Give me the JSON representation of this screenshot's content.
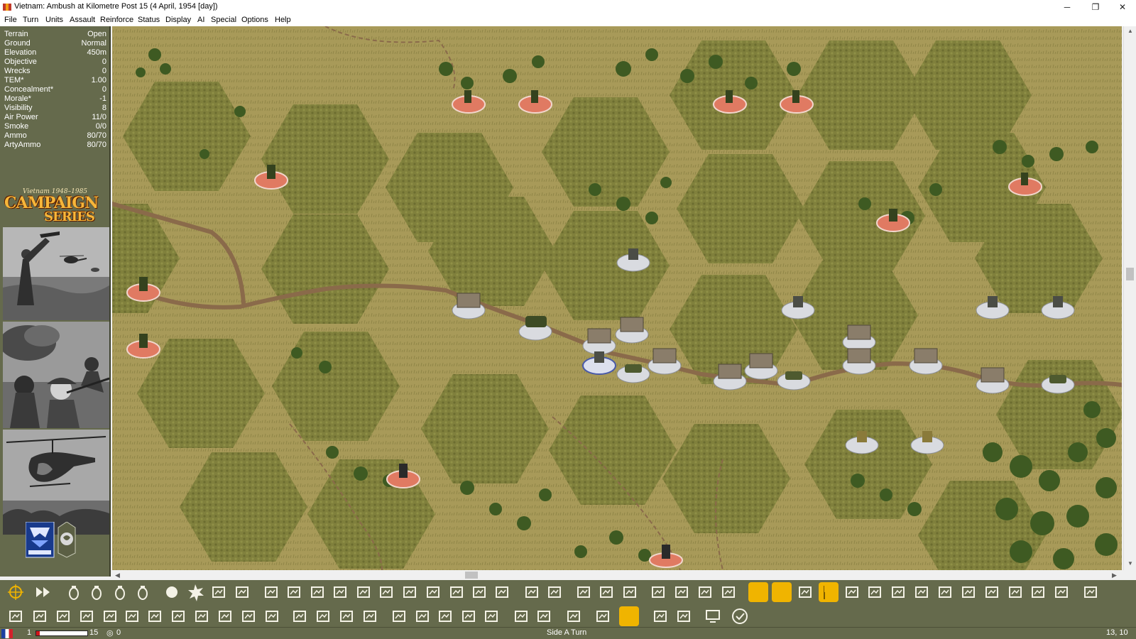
{
  "window": {
    "title": "Vietnam: Ambush at Kilometre Post 15 (4 April, 1954 [day])",
    "controls": {
      "minimize": "─",
      "maximize": "❐",
      "close": "✕"
    }
  },
  "menu": [
    "File",
    "Turn",
    "Units",
    "Assault",
    "Reinforce",
    "Status",
    "Display",
    "AI",
    "Special",
    "Options",
    "Help"
  ],
  "info_panel": [
    {
      "label": "Terrain",
      "value": "Open"
    },
    {
      "label": "Ground",
      "value": "Normal"
    },
    {
      "label": "Elevation",
      "value": "450m"
    },
    {
      "label": "Objective",
      "value": "0"
    },
    {
      "label": "Wrecks",
      "value": "0"
    },
    {
      "label": "TEM*",
      "value": "1.00"
    },
    {
      "label": "Concealment*",
      "value": "0"
    },
    {
      "label": "Morale*",
      "value": "-1"
    },
    {
      "label": "Visibility",
      "value": "8"
    },
    {
      "label": "Air Power",
      "value": "11/0"
    },
    {
      "label": "Smoke",
      "value": "0/0"
    },
    {
      "label": "Ammo",
      "value": "80/70"
    },
    {
      "label": "ArtyAmmo",
      "value": "80/70"
    }
  ],
  "logo": {
    "subtitle": "Vietnam 1948–1985",
    "line1": "CAMPAIGN",
    "line2": "SERIES"
  },
  "scrollbars": {
    "up": "▲",
    "down": "▼",
    "left": "◀",
    "right": "▶"
  },
  "colors": {
    "panel_bg": "#656a4c",
    "map_open": "#a89a59",
    "brush": "#7e7f3b",
    "road": "#8a6a4a",
    "enemy_unit": "#e07a62",
    "friendly_unit": "#d9dbe0",
    "highlight": "#f0b400"
  },
  "toolbar_row1": [
    "target-icon",
    "fast-forward-icon",
    "hand-grenade-icon",
    "hand-grenade-icon",
    "hand-grenade-icon",
    "hand-grenade-icon",
    "smoke-icon",
    "explosion-icon",
    "los-icon",
    "scissors-icon",
    "vehicle-icon",
    "wrench-icon",
    "chart-icon",
    "aircraft-icon",
    "bunker-icon",
    "bunker-icon",
    "building-icon",
    "ladder-icon",
    "rifle-icon",
    "rifle-icon",
    "shovel-icon",
    "helicopter-icon",
    "helicopter-icon",
    "airstrike-icon",
    "transport-icon",
    "mount-icon",
    "dismount-icon",
    "unit-group-icon",
    "gun-icon",
    "truck-icon",
    "speedometer-icon",
    "oval-icon",
    "flag-outline-icon",
    "flag-icon",
    "map-icon",
    "crossed-tools-icon",
    "group-icon",
    "star-icon",
    "map-icon",
    "map-icon",
    "compass-icon",
    "hexes-icon",
    "rotate-icon",
    "report-icon",
    "picture-icon"
  ],
  "toolbar_row2": [
    "move-icon",
    "terrain-icon",
    "building-icon",
    "fort-icon",
    "fire-icon",
    "truck-icon",
    "rifle-icon",
    "mortar-icon",
    "artillery-icon",
    "hq-icon",
    "hq-label-icon",
    "org-chart-icon",
    "mine-icon",
    "mine-icon",
    "mine-icon",
    "mine-icon",
    "mine-clear-icon",
    "mine-clear-icon",
    "document-icon",
    "plus-box-icon",
    "copy-icon",
    "arrow-left-box-icon",
    "arrow-right-box-icon",
    "hierarchy-icon",
    "magnify-icon",
    "coin-icon",
    "mail-icon",
    "report-icon",
    "computer-icon",
    "check-icon"
  ],
  "status": {
    "turn_current": "1",
    "turn_total": "15",
    "turn_progress": 0.07,
    "score": "0",
    "phase": "Side A Turn",
    "coords": "13, 10"
  }
}
